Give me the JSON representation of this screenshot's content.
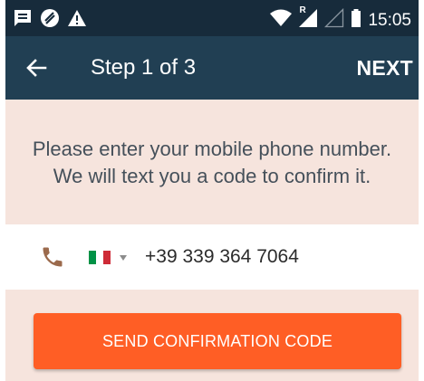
{
  "status_bar": {
    "time": "15:05",
    "left_icons": [
      "message-icon",
      "hangouts-icon",
      "warning-icon"
    ],
    "right_icons": [
      "wifi-icon",
      "signal-roaming-icon",
      "signal-empty-icon",
      "battery-icon"
    ],
    "roaming_letter": "R"
  },
  "app_bar": {
    "back_icon": "arrow-back-icon",
    "title": "Step 1 of 3",
    "next_label": "NEXT"
  },
  "instructions": {
    "line1": "Please enter your mobile phone number.",
    "line2": "We will text you a code to confirm it."
  },
  "phone_entry": {
    "icon": "phone-icon",
    "country_flag": "italy-flag-icon",
    "phone_number": "+39 339 364 7064"
  },
  "send_button": {
    "label": "SEND CONFIRMATION CODE"
  },
  "colors": {
    "status_bar_bg": "#172b3b",
    "app_bar_bg": "#213f53",
    "page_bg": "#f6e4dd",
    "accent": "#ff5e25",
    "phone_icon": "#9b6a4c"
  }
}
